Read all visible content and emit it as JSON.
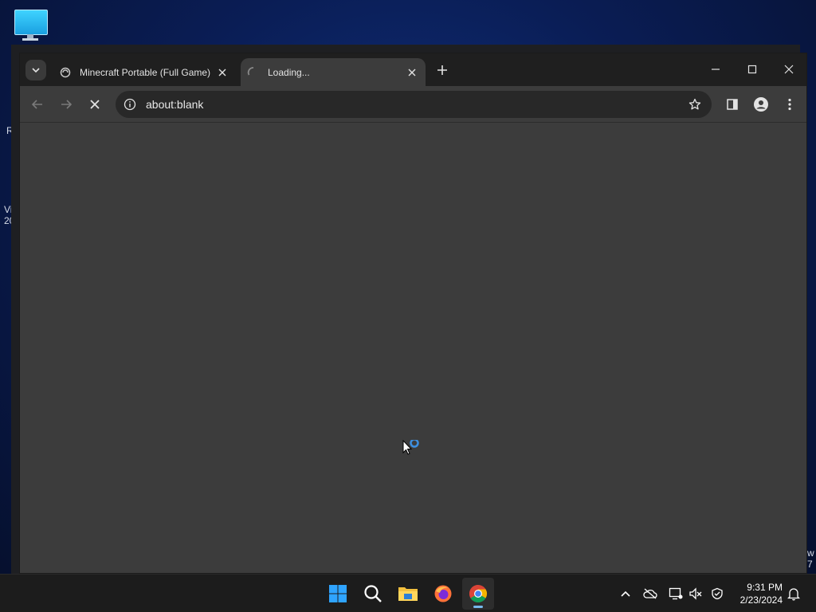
{
  "desktop": {
    "icon_name": "this-pc-icon",
    "edge_texts": [
      "R",
      "Vi",
      "20",
      "w",
      "7"
    ]
  },
  "browser": {
    "tabs": [
      {
        "title": "Minecraft Portable (Full Game)",
        "state": "inactive"
      },
      {
        "title": "Loading...",
        "state": "active"
      }
    ],
    "address": "about:blank"
  },
  "taskbar": {
    "apps": [
      "start",
      "search",
      "file-explorer",
      "firefox",
      "chrome"
    ],
    "active_app": "chrome",
    "clock": {
      "time": "9:31 PM",
      "date": "2/23/2024"
    }
  },
  "colors": {
    "accent": "#76b9ed",
    "tab_strip": "#1f1f1f",
    "toolbar": "#3c3c3c",
    "omnibox": "#282828"
  }
}
